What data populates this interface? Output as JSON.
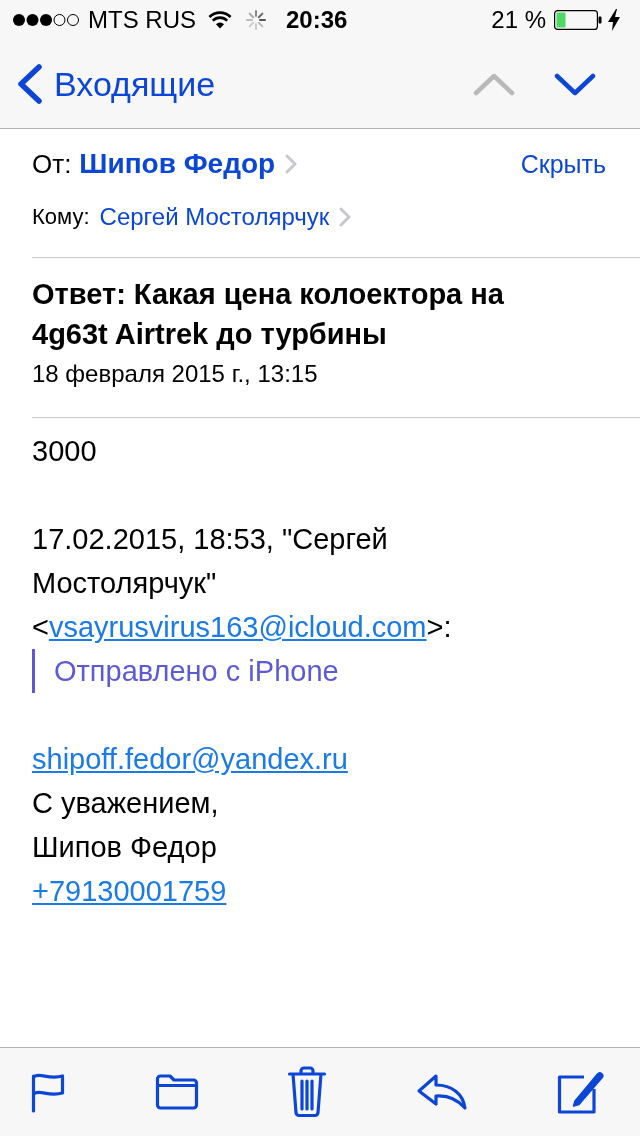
{
  "status_bar": {
    "carrier": "MTS RUS",
    "time": "20:36",
    "battery": "21 %"
  },
  "nav_bar": {
    "back_label": "Входящие",
    "previous": {
      "disabled": true
    },
    "next": {
      "disabled": false
    }
  },
  "header": {
    "from_label": "От:",
    "from_name": "Шипов Федор",
    "hide_link": "Скрыть",
    "to_label": "Кому:",
    "to_name": "Сергей Мостолярчук",
    "subject": "Ответ: Какая цена колоектора на 4g63t Airtrek до турбины",
    "date": "18 февраля 2015 г., 13:15"
  },
  "body": [
    {
      "kind": "text",
      "text": "3000"
    },
    {
      "kind": "attribution",
      "text": "17.02.2015, 18:53, \"Сергей Мостолярчук\" <",
      "link": "vsayrusvirus163@icloud.com",
      "text_after": ">:"
    },
    {
      "kind": "quote",
      "text": "Отправлено с iPhone"
    },
    {
      "kind": "signature",
      "lines": [
        {
          "kind": "link",
          "text": "shipoff.fedor@yandex.ru"
        },
        {
          "kind": "text",
          "text": "С уважением,"
        },
        {
          "kind": "text",
          "text": "Шипов Федор"
        },
        {
          "kind": "link",
          "text": "+79130001759"
        }
      ]
    }
  ]
}
